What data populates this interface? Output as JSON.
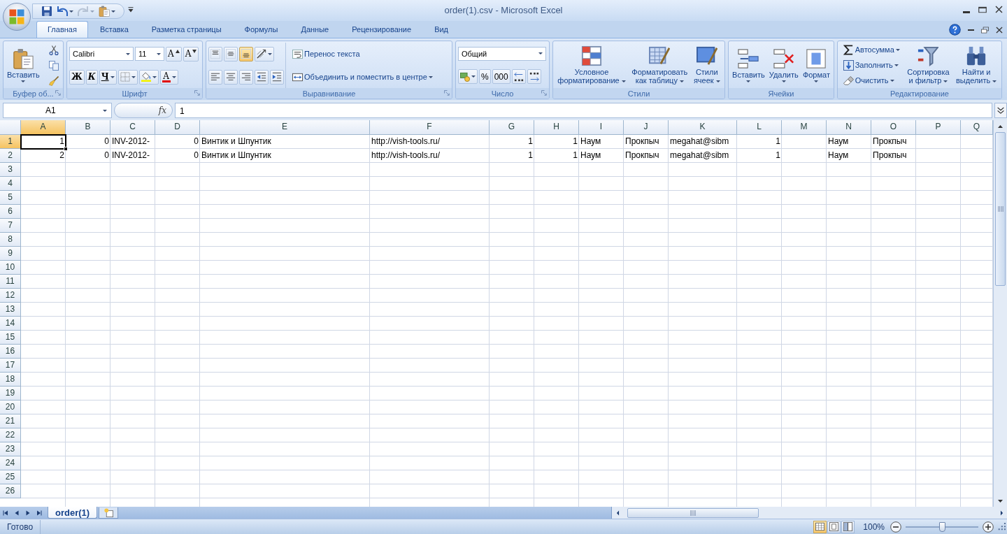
{
  "window": {
    "title": "order(1).csv - Microsoft Excel"
  },
  "quick_access": [
    {
      "dropdown": false,
      "disabled": false
    },
    {
      "dropdown": true,
      "disabled": false
    },
    {
      "dropdown": true,
      "disabled": true
    },
    {
      "dropdown": true,
      "disabled": false
    }
  ],
  "tabs": [
    {
      "label": "Главная",
      "selected": true
    },
    {
      "label": "Вставка",
      "selected": false
    },
    {
      "label": "Разметка страницы",
      "selected": false
    },
    {
      "label": "Формулы",
      "selected": false
    },
    {
      "label": "Данные",
      "selected": false
    },
    {
      "label": "Рецензирование",
      "selected": false
    },
    {
      "label": "Вид",
      "selected": false
    }
  ],
  "ribbon": [
    {
      "label": "Буфер об...",
      "launcher": true,
      "columns": [
        [
          [
            {
              "kind": "big",
              "label": "Вставить",
              "dropdown": true,
              "selected": false
            }
          ]
        ],
        [
          [
            {
              "kind": "icon",
              "dropdown": false,
              "selected": false
            }
          ],
          [
            {
              "kind": "icon",
              "dropdown": false,
              "selected": false
            }
          ],
          [
            {
              "kind": "icon",
              "dropdown": false,
              "selected": false
            }
          ]
        ]
      ]
    },
    {
      "label": "Шрифт",
      "launcher": true,
      "columns": [
        [
          [
            {
              "kind": "combo",
              "value": "Calibri"
            },
            {
              "kind": "combo",
              "value": "11"
            },
            {
              "kind": "letter",
              "label": "A",
              "dropdown": false,
              "selected": false
            },
            {
              "kind": "letter",
              "label": "A",
              "dropdown": false,
              "selected": false
            }
          ],
          [
            {
              "kind": "letter",
              "label": "Ж",
              "dropdown": false,
              "selected": false
            },
            {
              "kind": "letter",
              "label": "К",
              "dropdown": false,
              "selected": false
            },
            {
              "kind": "letter",
              "label": "Ч",
              "dropdown": true,
              "selected": false
            },
            {
              "kind": "icon",
              "dropdown": true,
              "selected": false
            },
            {
              "kind": "icon",
              "dropdown": true,
              "selected": false
            },
            {
              "kind": "letter",
              "label": "A",
              "dropdown": true,
              "selected": false
            }
          ]
        ]
      ]
    },
    {
      "label": "Выравнивание",
      "launcher": true,
      "columns": [
        [
          [
            {
              "kind": "icon",
              "dropdown": false,
              "selected": false
            },
            {
              "kind": "icon",
              "dropdown": false,
              "selected": false
            },
            {
              "kind": "icon",
              "dropdown": false,
              "selected": true
            },
            {
              "kind": "icon",
              "dropdown": true,
              "selected": false
            }
          ],
          [
            {
              "kind": "icon",
              "dropdown": false,
              "selected": false
            },
            {
              "kind": "icon",
              "dropdown": false,
              "selected": false
            },
            {
              "kind": "icon",
              "dropdown": false,
              "selected": false
            },
            {
              "kind": "icon",
              "dropdown": false,
              "selected": false
            },
            {
              "kind": "icon",
              "dropdown": false,
              "selected": false
            }
          ]
        ],
        [
          [
            {
              "kind": "button",
              "label": "Перенос текста",
              "dropdown": false,
              "selected": false
            }
          ],
          [
            {
              "kind": "button",
              "label": "Объединить и поместить в центре",
              "dropdown": true,
              "selected": false
            }
          ]
        ]
      ]
    },
    {
      "label": "Число",
      "launcher": true,
      "columns": [
        [
          [
            {
              "kind": "combo",
              "value": "Общий"
            }
          ],
          [
            {
              "kind": "icon",
              "dropdown": true,
              "selected": false
            },
            {
              "kind": "letter",
              "label": "%",
              "dropdown": false,
              "selected": false
            },
            {
              "kind": "letter",
              "label": "000",
              "dropdown": false,
              "selected": false
            },
            {
              "kind": "icon",
              "dropdown": false,
              "selected": false
            },
            {
              "kind": "icon",
              "dropdown": false,
              "selected": false
            }
          ]
        ]
      ]
    },
    {
      "label": "Стили",
      "launcher": false,
      "columns": [
        [
          [
            {
              "kind": "big",
              "label": "Условное\nформатирование",
              "dropdown": true,
              "selected": false
            }
          ]
        ],
        [
          [
            {
              "kind": "big",
              "label": "Форматировать\nкак таблицу",
              "dropdown": true,
              "selected": false
            }
          ]
        ],
        [
          [
            {
              "kind": "big",
              "label": "Стили\nячеек",
              "dropdown": true,
              "selected": false
            }
          ]
        ]
      ]
    },
    {
      "label": "Ячейки",
      "launcher": false,
      "columns": [
        [
          [
            {
              "kind": "big",
              "label": "Вставить",
              "dropdown": true,
              "selected": false
            }
          ]
        ],
        [
          [
            {
              "kind": "big",
              "label": "Удалить",
              "dropdown": true,
              "selected": false
            }
          ]
        ],
        [
          [
            {
              "kind": "big",
              "label": "Формат",
              "dropdown": true,
              "selected": false
            }
          ]
        ]
      ]
    },
    {
      "label": "Редактирование",
      "launcher": false,
      "columns": [
        [
          [
            {
              "kind": "button",
              "label": "Автосумма",
              "dropdown": true,
              "selected": false
            }
          ],
          [
            {
              "kind": "button",
              "label": "Заполнить",
              "dropdown": true,
              "selected": false
            }
          ],
          [
            {
              "kind": "button",
              "label": "Очистить",
              "dropdown": true,
              "selected": false
            }
          ]
        ],
        [
          [
            {
              "kind": "big",
              "label": "Сортировка\nи фильтр",
              "dropdown": true,
              "selected": false
            }
          ]
        ],
        [
          [
            {
              "kind": "big",
              "label": "Найти и\nвыделить",
              "dropdown": true,
              "selected": false
            }
          ]
        ]
      ]
    }
  ],
  "formula_bar": {
    "name_box": "A1",
    "fx_label": "fx",
    "value": "1"
  },
  "columns": [
    {
      "letter": "A",
      "selected": true
    },
    {
      "letter": "B",
      "selected": false
    },
    {
      "letter": "C",
      "selected": false
    },
    {
      "letter": "D",
      "selected": false
    },
    {
      "letter": "E",
      "selected": false
    },
    {
      "letter": "F",
      "selected": false
    },
    {
      "letter": "G",
      "selected": false
    },
    {
      "letter": "H",
      "selected": false
    },
    {
      "letter": "I",
      "selected": false
    },
    {
      "letter": "J",
      "selected": false
    },
    {
      "letter": "K",
      "selected": false
    },
    {
      "letter": "L",
      "selected": false
    },
    {
      "letter": "M",
      "selected": false
    },
    {
      "letter": "N",
      "selected": false
    },
    {
      "letter": "O",
      "selected": false
    },
    {
      "letter": "P",
      "selected": false
    },
    {
      "letter": "Q",
      "selected": false
    }
  ],
  "rows": [
    {
      "header": "1",
      "selected": true,
      "cells": [
        {
          "kind": "number",
          "text": "1",
          "active": true
        },
        {
          "kind": "number",
          "text": "0",
          "active": false
        },
        {
          "kind": "text",
          "text": "INV-2012-",
          "active": false
        },
        {
          "kind": "number",
          "text": "0",
          "active": false
        },
        {
          "kind": "text",
          "text": "Винтик и Шпунтик",
          "active": false
        },
        {
          "kind": "text",
          "text": "http://vish-tools.ru/",
          "active": false
        },
        {
          "kind": "number",
          "text": "1",
          "active": false
        },
        {
          "kind": "number",
          "text": "1",
          "active": false
        },
        {
          "kind": "text",
          "text": "Наум",
          "active": false
        },
        {
          "kind": "text",
          "text": "Прокпыч",
          "active": false
        },
        {
          "kind": "text",
          "text": "megahat@sibm",
          "active": false
        },
        {
          "kind": "number",
          "text": "1",
          "active": false
        },
        {
          "kind": "empty"
        },
        {
          "kind": "text",
          "text": "Наум",
          "active": false
        },
        {
          "kind": "text",
          "text": "Прокпыч",
          "active": false
        }
      ]
    },
    {
      "header": "2",
      "selected": false,
      "cells": [
        {
          "kind": "number",
          "text": "2",
          "active": false
        },
        {
          "kind": "number",
          "text": "0",
          "active": false
        },
        {
          "kind": "text",
          "text": "INV-2012-",
          "active": false
        },
        {
          "kind": "number",
          "text": "0",
          "active": false
        },
        {
          "kind": "text",
          "text": "Винтик и Шпунтик",
          "active": false
        },
        {
          "kind": "text",
          "text": "http://vish-tools.ru/",
          "active": false
        },
        {
          "kind": "number",
          "text": "1",
          "active": false
        },
        {
          "kind": "number",
          "text": "1",
          "active": false
        },
        {
          "kind": "text",
          "text": "Наум",
          "active": false
        },
        {
          "kind": "text",
          "text": "Прокпыч",
          "active": false
        },
        {
          "kind": "text",
          "text": "megahat@sibm",
          "active": false
        },
        {
          "kind": "number",
          "text": "1",
          "active": false
        },
        {
          "kind": "empty"
        },
        {
          "kind": "text",
          "text": "Наум",
          "active": false
        },
        {
          "kind": "text",
          "text": "Прокпыч",
          "active": false
        }
      ]
    },
    {
      "header": "3",
      "selected": false
    },
    {
      "header": "4",
      "selected": false
    },
    {
      "header": "5",
      "selected": false
    },
    {
      "header": "6",
      "selected": false
    },
    {
      "header": "7",
      "selected": false
    },
    {
      "header": "8",
      "selected": false
    },
    {
      "header": "9",
      "selected": false
    },
    {
      "header": "10",
      "selected": false
    },
    {
      "header": "11",
      "selected": false
    },
    {
      "header": "12",
      "selected": false
    },
    {
      "header": "13",
      "selected": false
    },
    {
      "header": "14",
      "selected": false
    },
    {
      "header": "15",
      "selected": false
    },
    {
      "header": "16",
      "selected": false
    },
    {
      "header": "17",
      "selected": false
    },
    {
      "header": "18",
      "selected": false
    },
    {
      "header": "19",
      "selected": false
    },
    {
      "header": "20",
      "selected": false
    },
    {
      "header": "21",
      "selected": false
    },
    {
      "header": "22",
      "selected": false
    },
    {
      "header": "23",
      "selected": false
    },
    {
      "header": "24",
      "selected": false
    },
    {
      "header": "25",
      "selected": false
    },
    {
      "header": "26",
      "selected": false
    }
  ],
  "sheet_tabs": [
    {
      "label": "order(1)",
      "selected": true
    }
  ],
  "status_bar": {
    "status": "Готово",
    "views": [
      {
        "selected": true
      },
      {
        "selected": false
      },
      {
        "selected": false
      }
    ],
    "zoom": "100%",
    "zoom_slider": {
      "level": 0.5
    }
  }
}
